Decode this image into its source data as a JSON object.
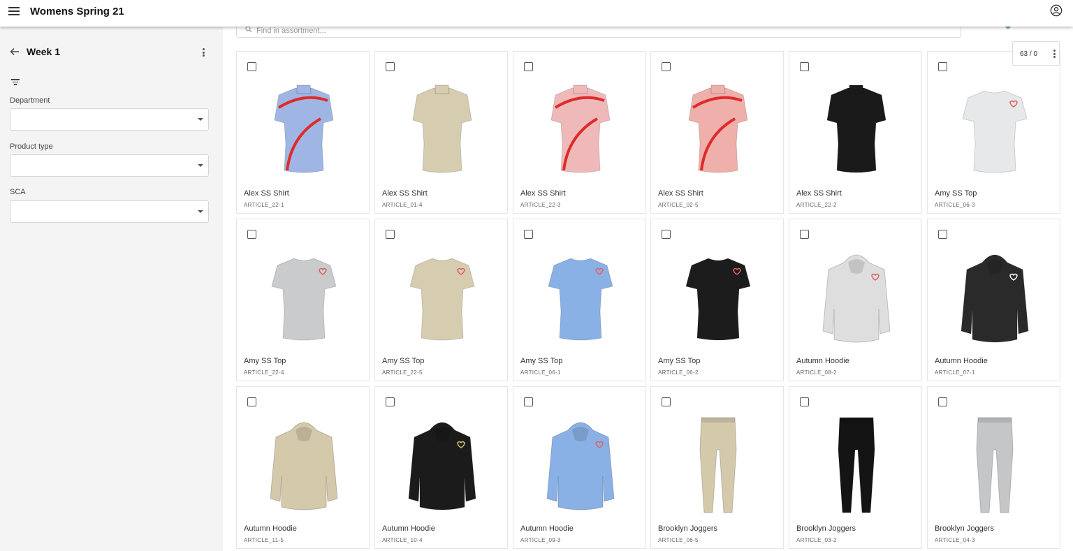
{
  "header": {
    "title": "Womens Spring 21"
  },
  "sidebar": {
    "back_title": "Week 1",
    "filters": [
      {
        "label": "Department",
        "value": ""
      },
      {
        "label": "Product type",
        "value": ""
      },
      {
        "label": "SCA",
        "value": ""
      }
    ]
  },
  "search": {
    "placeholder": "Find in assortment..."
  },
  "counter": "63 / 0",
  "products": [
    {
      "name": "Alex SS Shirt",
      "code": "ARTICLE_22-1",
      "kind": "shirt",
      "color": "#9fb6e4",
      "accent": "#e02a2a"
    },
    {
      "name": "Alex SS Shirt",
      "code": "ARTICLE_01-4",
      "kind": "shirt",
      "color": "#d6ccb0",
      "accent": ""
    },
    {
      "name": "Alex SS Shirt",
      "code": "ARTICLE_22-3",
      "kind": "shirt",
      "color": "#f0b9b9",
      "accent": "#e02a2a"
    },
    {
      "name": "Alex SS Shirt",
      "code": "ARTICLE_02-5",
      "kind": "shirt",
      "color": "#efb0ac",
      "accent": "#e02a2a"
    },
    {
      "name": "Alex SS Shirt",
      "code": "ARTICLE_22-2",
      "kind": "shirt",
      "color": "#1a1a1a",
      "accent": ""
    },
    {
      "name": "Amy SS Top",
      "code": "ARTICLE_06-3",
      "kind": "tee",
      "color": "#e6e8ea",
      "accent": "#e06060"
    },
    {
      "name": "Amy SS Top",
      "code": "ARTICLE_22-4",
      "kind": "tee",
      "color": "#c9cbcc",
      "accent": "#e06060"
    },
    {
      "name": "Amy SS Top",
      "code": "ARTICLE_22-5",
      "kind": "tee",
      "color": "#d6ccb0",
      "accent": "#e06060"
    },
    {
      "name": "Amy SS Top",
      "code": "ARTICLE_06-1",
      "kind": "tee",
      "color": "#8ab1e6",
      "accent": "#e06060"
    },
    {
      "name": "Amy SS Top",
      "code": "ARTICLE_06-2",
      "kind": "tee",
      "color": "#1c1c1c",
      "accent": "#e06060"
    },
    {
      "name": "Autumn Hoodie",
      "code": "ARTICLE_08-2",
      "kind": "hoodie",
      "color": "#dedede",
      "accent": "#e06060"
    },
    {
      "name": "Autumn Hoodie",
      "code": "ARTICLE_07-1",
      "kind": "hoodie",
      "color": "#2a2a2a",
      "accent": "#ffffff"
    },
    {
      "name": "Autumn Hoodie",
      "code": "ARTICLE_11-5",
      "kind": "hoodie",
      "color": "#d4c9ab",
      "accent": ""
    },
    {
      "name": "Autumn Hoodie",
      "code": "ARTICLE_10-4",
      "kind": "hoodie",
      "color": "#1b1b1b",
      "accent": "#c9c470"
    },
    {
      "name": "Autumn Hoodie",
      "code": "ARTICLE_09-3",
      "kind": "hoodie",
      "color": "#8ab1e6",
      "accent": "#e06060"
    },
    {
      "name": "Brooklyn Joggers",
      "code": "ARTICLE_06-5",
      "kind": "pants",
      "color": "#d4c9ab",
      "accent": ""
    },
    {
      "name": "Brooklyn Joggers",
      "code": "ARTICLE_03-2",
      "kind": "pants",
      "color": "#141414",
      "accent": ""
    },
    {
      "name": "Brooklyn Joggers",
      "code": "ARTICLE_04-3",
      "kind": "pants",
      "color": "#c4c6c8",
      "accent": ""
    }
  ]
}
